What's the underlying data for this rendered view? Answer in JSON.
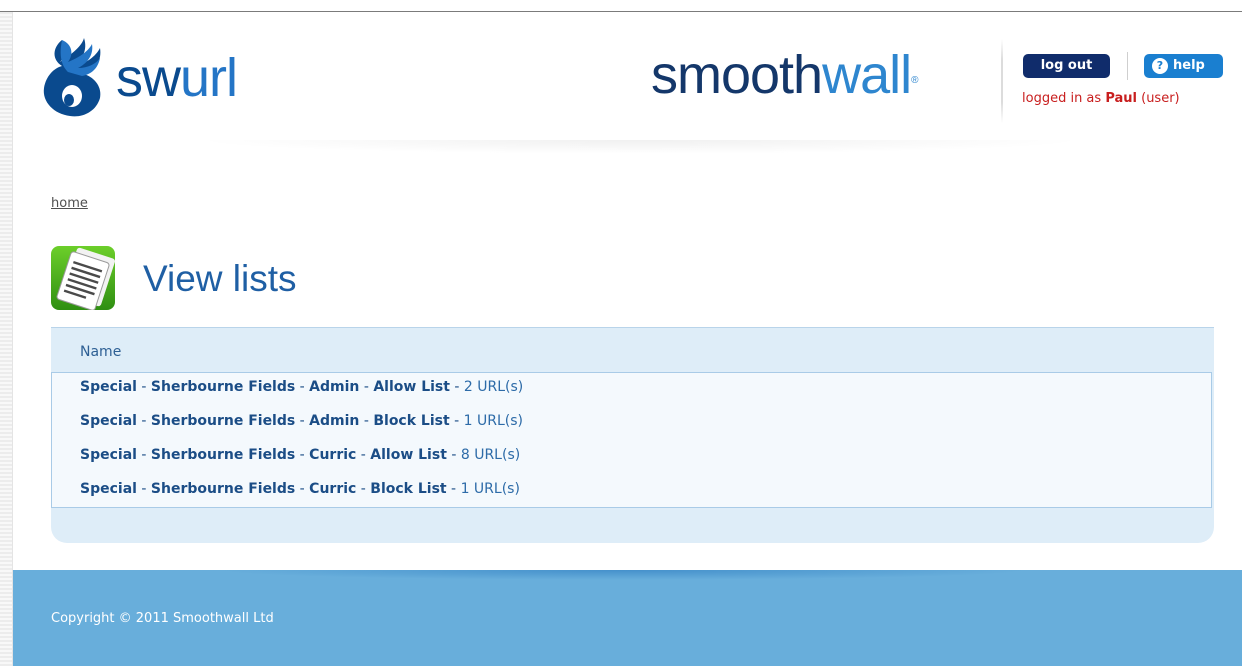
{
  "header": {
    "brand_sw": "sw",
    "brand_url": "url",
    "vendor_smooth": "smooth",
    "vendor_wall": "wall",
    "vendor_tm": "®",
    "logout_label": "log out",
    "help_label": "help",
    "help_icon_glyph": "?",
    "logged_in_prefix": "logged in as ",
    "user_name": "Paul",
    "user_role": " (user)"
  },
  "breadcrumb": {
    "home_label": "home"
  },
  "page": {
    "title": "View lists"
  },
  "lists": {
    "column_header": "Name",
    "rows": [
      {
        "category": "Special",
        "site": "Sherbourne Fields",
        "group": "Admin",
        "list_type": "Allow List",
        "count": "2 URL(s)"
      },
      {
        "category": "Special",
        "site": "Sherbourne Fields",
        "group": "Admin",
        "list_type": "Block List",
        "count": "1 URL(s)"
      },
      {
        "category": "Special",
        "site": "Sherbourne Fields",
        "group": "Curric",
        "list_type": "Allow List",
        "count": "8 URL(s)"
      },
      {
        "category": "Special",
        "site": "Sherbourne Fields",
        "group": "Curric",
        "list_type": "Block List",
        "count": "1 URL(s)"
      }
    ],
    "separator": " - "
  },
  "footer": {
    "copyright": "Copyright © 2011 Smoothwall Ltd"
  },
  "colors": {
    "brand_dark": "#0a4a8e",
    "brand_light": "#2475c6",
    "logout_bg": "#102c6b",
    "help_bg": "#1a7fd0",
    "user_text": "#c81e1e",
    "footer_bg": "#68aedb",
    "panel_bg": "#deedf8"
  },
  "icons": {
    "brand_logo": "swurl-swirl-icon",
    "page_icon": "document-list-icon"
  }
}
